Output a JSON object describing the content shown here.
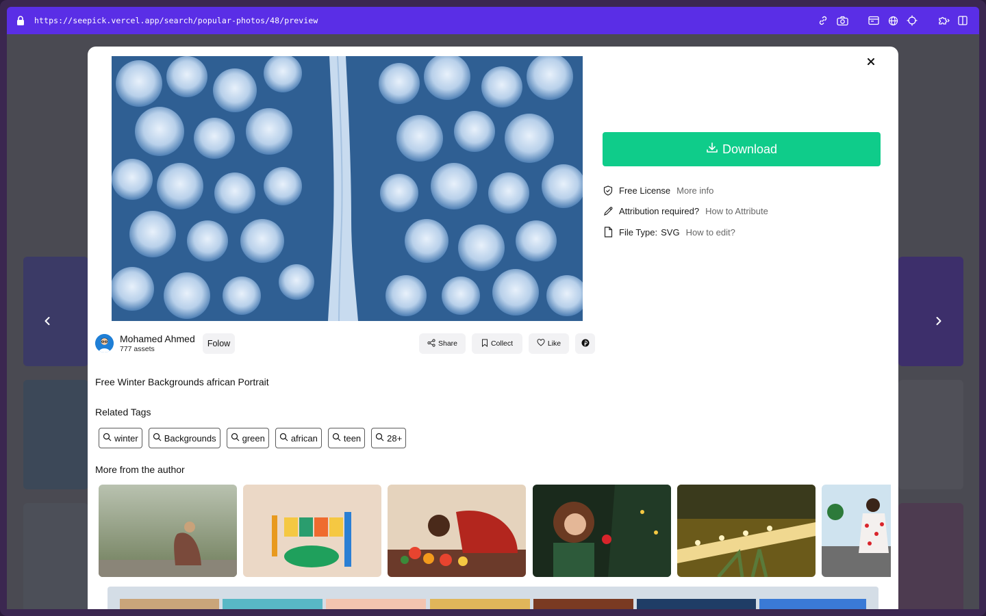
{
  "browser": {
    "url": "https://seepick.vercel.app/search/popular-photos/48/preview",
    "toolbar_icons": [
      "link-icon",
      "camera-icon",
      "window-icon",
      "globe-icon",
      "crosshair-icon",
      "extension-icon",
      "sidebar-icon"
    ]
  },
  "colors": {
    "address_bar": "#5a2ee6",
    "download": "#0fcc8a"
  },
  "modal": {
    "download_label": "Download",
    "license": {
      "label": "Free License",
      "link": "More info"
    },
    "attribution": {
      "label": "Attribution required?",
      "link": "How to Attribute"
    },
    "file_type": {
      "label": "File Type:",
      "value": "SVG",
      "link": "How to edit?"
    },
    "author": {
      "name": "Mohamed Ahmed",
      "assets": "777 assets",
      "follow_label": "Folow"
    },
    "actions": {
      "share": "Share",
      "collect": "Collect",
      "like": "Like"
    },
    "title": "Free Winter Backgrounds african Portrait",
    "related_tags_label": "Related Tags",
    "tags": [
      "winter",
      "Backgrounds",
      "green",
      "african",
      "teen",
      "28+"
    ],
    "more_label": "More from the author"
  }
}
